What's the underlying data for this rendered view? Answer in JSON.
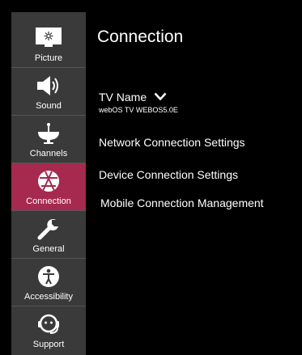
{
  "sidebar": {
    "items": [
      {
        "label": "Picture",
        "icon": "picture-icon"
      },
      {
        "label": "Sound",
        "icon": "speaker-icon"
      },
      {
        "label": "Channels",
        "icon": "satellite-dish-icon"
      },
      {
        "label": "Connection",
        "icon": "connection-globe-icon",
        "active": true
      },
      {
        "label": "General",
        "icon": "wrench-icon"
      },
      {
        "label": "Accessibility",
        "icon": "accessibility-icon"
      },
      {
        "label": "Support",
        "icon": "headset-support-icon"
      }
    ],
    "accent_color": "#a6294f",
    "background_color": "#3a3a3a"
  },
  "main": {
    "title": "Connection",
    "tv_name": {
      "label": "TV Name",
      "value": "webOS TV WEBOS5.0E"
    },
    "menu": [
      {
        "label": "Network Connection Settings"
      },
      {
        "label": "Device Connection Settings"
      },
      {
        "label": "Mobile Connection Management"
      }
    ]
  }
}
